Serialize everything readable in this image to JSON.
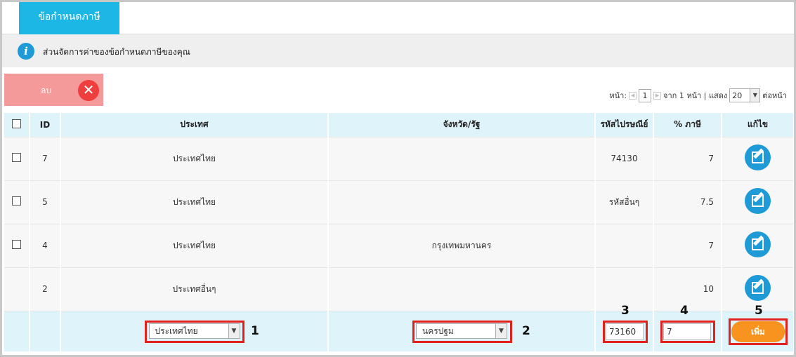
{
  "tab": {
    "label": "ข้อกำหนดภาษี"
  },
  "info": {
    "text": "ส่วนจัดการค่าของข้อกำหนดภาษีของคุณ"
  },
  "toolbar": {
    "delete_label": "ลบ"
  },
  "pager": {
    "page_label": "หน้า:",
    "page_value": "1",
    "of_text": "จาก 1 หน้า | แสดง",
    "per_page": "20",
    "per_page_suffix": "ต่อหน้า"
  },
  "table": {
    "headers": [
      "ID",
      "ประเทศ",
      "จังหวัด/รัฐ",
      "รหัสไปรษณีย์",
      "% ภาษี",
      "แก้ไข"
    ],
    "rows": [
      {
        "id": "7",
        "country": "ประเทศไทย",
        "province": "",
        "postal": "74130",
        "tax": "7"
      },
      {
        "id": "5",
        "country": "ประเทศไทย",
        "province": "",
        "postal": "รหัสอื่นๆ",
        "tax": "7.5"
      },
      {
        "id": "4",
        "country": "ประเทศไทย",
        "province": "กรุงเทพมหานคร",
        "postal": "",
        "tax": "7"
      },
      {
        "id": "2",
        "country": "ประเทศอื่นๆ",
        "province": "",
        "postal": "",
        "tax": "10"
      }
    ]
  },
  "form": {
    "country_value": "ประเทศไทย",
    "province_value": "นครปฐม",
    "postal_value": "73160",
    "tax_value": "7",
    "add_label": "เพิ่ม",
    "callouts": [
      "1",
      "2",
      "3",
      "4",
      "5"
    ]
  },
  "colors": {
    "tab": "#1db7e6",
    "header": "#dff3fb",
    "delete": "#f59a9b",
    "add": "#f7931e",
    "edit": "#1e9bd7",
    "highlight": "#e2211c"
  }
}
